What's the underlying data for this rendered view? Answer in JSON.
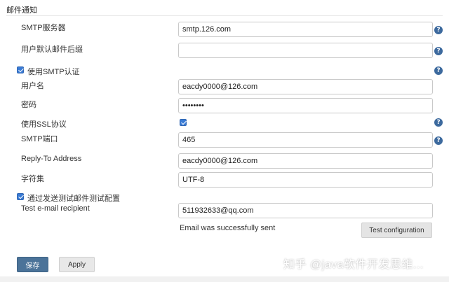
{
  "section": {
    "title": "邮件通知"
  },
  "fields": {
    "smtp_server": {
      "label": "SMTP服务器",
      "value": "smtp.126.com"
    },
    "default_suffix": {
      "label": "用户默认邮件后缀",
      "value": ""
    },
    "use_smtp_auth": {
      "label": "使用SMTP认证",
      "checked": true
    },
    "username": {
      "label": "用户名",
      "value": "eacdy0000@126.com"
    },
    "password": {
      "label": "密码",
      "value": "••••••••"
    },
    "use_ssl": {
      "label": "使用SSL协议",
      "checked": true
    },
    "smtp_port": {
      "label": "SMTP端口",
      "value": "465"
    },
    "reply_to": {
      "label": "Reply-To Address",
      "value": "eacdy0000@126.com"
    },
    "charset": {
      "label": "字符集",
      "value": "UTF-8"
    },
    "send_test": {
      "label": "通过发送测试邮件测试配置",
      "checked": true
    },
    "test_recipient": {
      "label": "Test e-mail recipient",
      "value": "511932633@qq.com"
    }
  },
  "status_text": "Email was successfully sent",
  "buttons": {
    "test_configuration": "Test configuration",
    "save": "保存",
    "apply": "Apply"
  },
  "help_glyph": "?",
  "watermark": "知乎 @java软件开发思维...",
  "colors": {
    "primary_button": "#4b7399",
    "help_icon": "#3d6a9e",
    "checkbox": "#3a7bd5"
  }
}
